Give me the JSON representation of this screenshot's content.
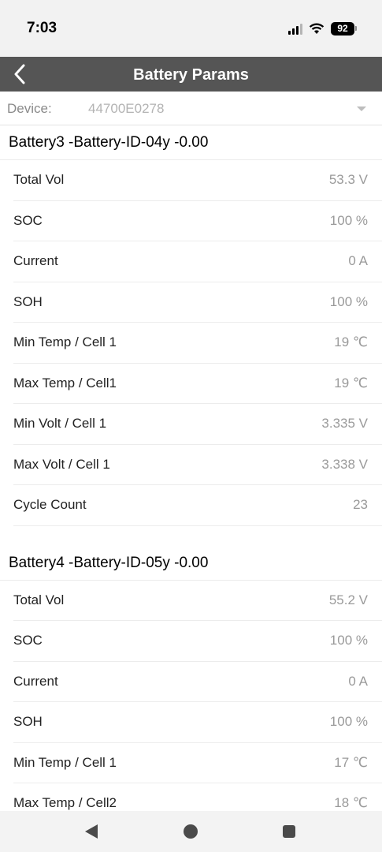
{
  "status_bar": {
    "time": "7:03",
    "battery_level": "92",
    "icons": [
      "signal-icon",
      "wifi-icon",
      "battery-icon"
    ]
  },
  "header": {
    "title": "Battery Params",
    "back_icon": "chevron-left-icon"
  },
  "device": {
    "label": "Device:",
    "value": "44700E0278",
    "dropdown_icon": "caret-down-icon"
  },
  "sections": [
    {
      "title": "Battery3 -Battery-ID-04y -0.00",
      "rows": [
        {
          "label": "Total Vol",
          "value": "53.3 V"
        },
        {
          "label": "SOC",
          "value": "100 %"
        },
        {
          "label": "Current",
          "value": "0 A"
        },
        {
          "label": "SOH",
          "value": "100 %"
        },
        {
          "label": "Min Temp / Cell 1",
          "value": "19 ℃"
        },
        {
          "label": "Max Temp / Cell1",
          "value": "19 ℃"
        },
        {
          "label": "Min Volt / Cell 1",
          "value": "3.335 V"
        },
        {
          "label": "Max Volt / Cell 1",
          "value": "3.338 V"
        },
        {
          "label": "Cycle Count",
          "value": "23"
        }
      ]
    },
    {
      "title": "Battery4 -Battery-ID-05y -0.00",
      "rows": [
        {
          "label": "Total Vol",
          "value": "55.2 V"
        },
        {
          "label": "SOC",
          "value": "100 %"
        },
        {
          "label": "Current",
          "value": "0 A"
        },
        {
          "label": "SOH",
          "value": "100 %"
        },
        {
          "label": "Min Temp / Cell 1",
          "value": "17 ℃"
        },
        {
          "label": "Max Temp / Cell2",
          "value": "18 ℃"
        }
      ]
    }
  ],
  "nav_bar": {
    "icons": [
      "nav-back-icon",
      "nav-home-icon",
      "nav-recents-icon"
    ]
  },
  "colors": {
    "header_bg": "#555555",
    "status_bg": "#f2f2f2",
    "value_text": "#9a9a9a",
    "label_text": "#222222"
  }
}
